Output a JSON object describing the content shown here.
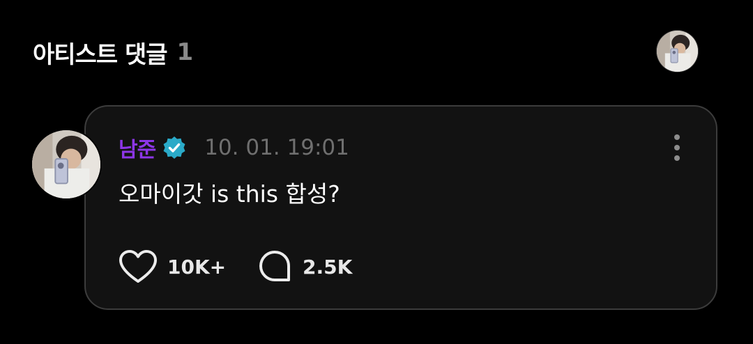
{
  "header": {
    "title": "아티스트 댓글",
    "count": "1"
  },
  "comment": {
    "author": "남준",
    "timestamp": "10. 01. 19:01",
    "text": "오마이갓 is this 합성?",
    "like_count": "10K+",
    "reply_count": "2.5K"
  },
  "icons": {
    "verified": "verified-badge-icon",
    "more": "more-vertical-icon",
    "like": "heart-icon",
    "reply": "speech-bubble-icon"
  },
  "colors": {
    "background": "#000000",
    "card_background": "#121212",
    "card_border": "#3c3c3c",
    "author": "#8d36e8",
    "verified_badge": "#2aaac8",
    "timestamp": "#6f6f6f",
    "header_count": "#8a8a8a"
  }
}
